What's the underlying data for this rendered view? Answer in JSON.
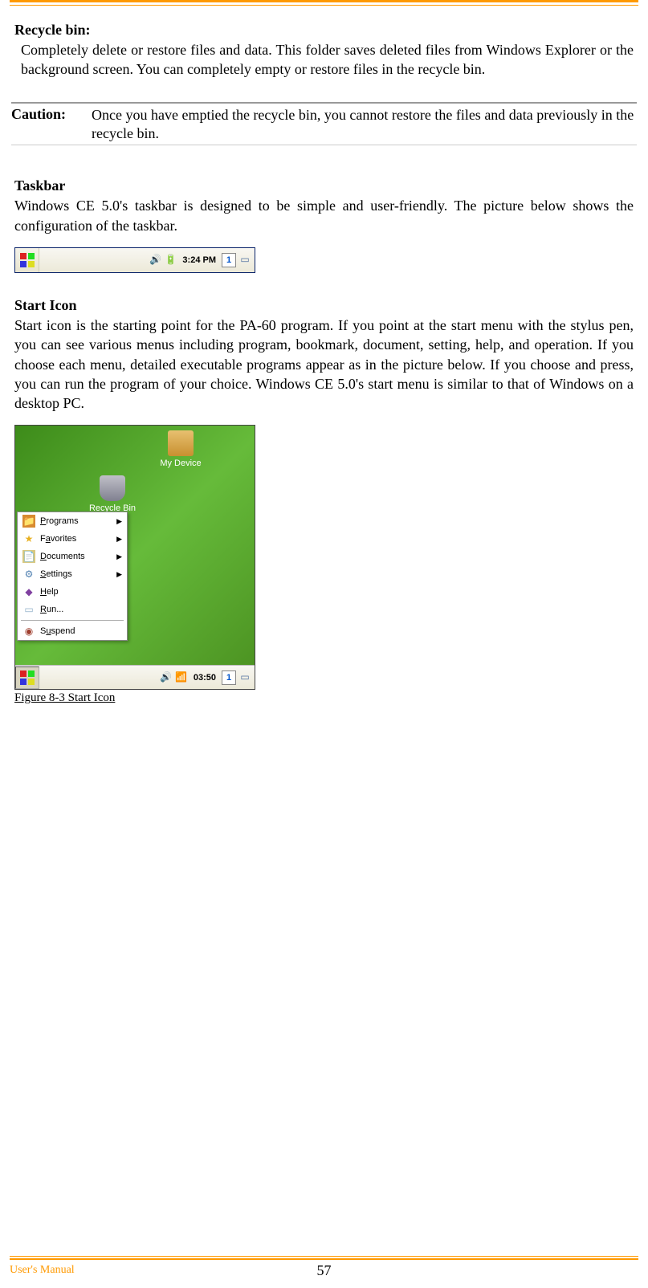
{
  "section1": {
    "heading": "Recycle bin:",
    "text": "Completely delete or restore files and data. This folder saves deleted files from Windows Explorer or the background screen. You can completely empty or restore files in the recycle bin."
  },
  "caution": {
    "label": "Caution:",
    "text": "Once you have emptied the recycle bin, you cannot restore the files and data previously in the recycle bin."
  },
  "section2": {
    "heading": "Taskbar",
    "text": "Windows CE 5.0's taskbar is designed to be simple and user-friendly. The picture below shows the configuration of the taskbar."
  },
  "taskbar": {
    "time": "3:24 PM",
    "indicator": "1"
  },
  "section3": {
    "heading": "Start Icon",
    "text": "Start icon is the starting point for the PA-60 program. If you point at the start menu with the stylus pen, you can see various menus including program, bookmark, document, setting, help, and operation. If you choose each menu, detailed executable programs appear as in the picture below. If you choose and press, you can run the program of your choice. Windows CE 5.0's start menu is similar to that of Windows on a desktop PC."
  },
  "desktop_icons": {
    "mydevice": "My Device",
    "recyclebin": "Recycle Bin"
  },
  "startmenu": {
    "items": [
      {
        "label": "Programs",
        "arrow": true,
        "icon_color": "#d88a30"
      },
      {
        "label": "Favorites",
        "arrow": true,
        "icon_color": "#e8c030"
      },
      {
        "label": "Documents",
        "arrow": true,
        "icon_color": "#d8c880"
      },
      {
        "label": "Settings",
        "arrow": true,
        "icon_color": "#5080b0"
      },
      {
        "label": "Help",
        "arrow": false,
        "icon_color": "#8040a0"
      },
      {
        "label": "Run...",
        "arrow": false,
        "icon_color": "#90b0c8"
      }
    ],
    "suspend": "Suspend",
    "taskbar_time": "03:50",
    "taskbar_indicator": "1"
  },
  "figure_caption": "Figure 8-3 Start Icon",
  "footer": {
    "label": "User's Manual",
    "page": "57"
  }
}
